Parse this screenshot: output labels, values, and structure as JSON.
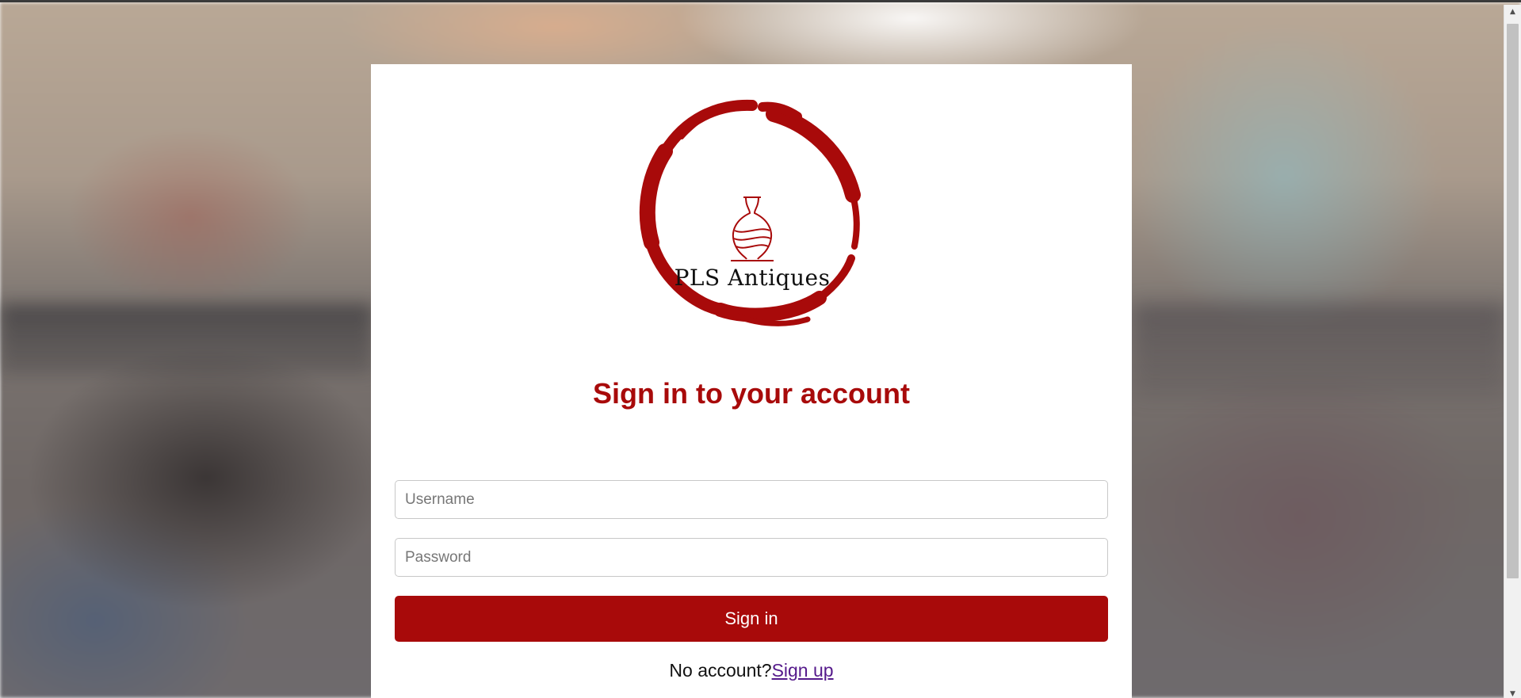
{
  "logo": {
    "brand_text": "PLS Antiques",
    "accent_color": "#a80a0a"
  },
  "login": {
    "heading": "Sign in to your account",
    "username_placeholder": "Username",
    "username_value": "",
    "password_placeholder": "Password",
    "password_value": "",
    "submit_label": "Sign in",
    "no_account_text": "No account?",
    "signup_link_label": "Sign up"
  },
  "scrollbar": {
    "up_arrow": "▲",
    "down_arrow": "▼"
  }
}
